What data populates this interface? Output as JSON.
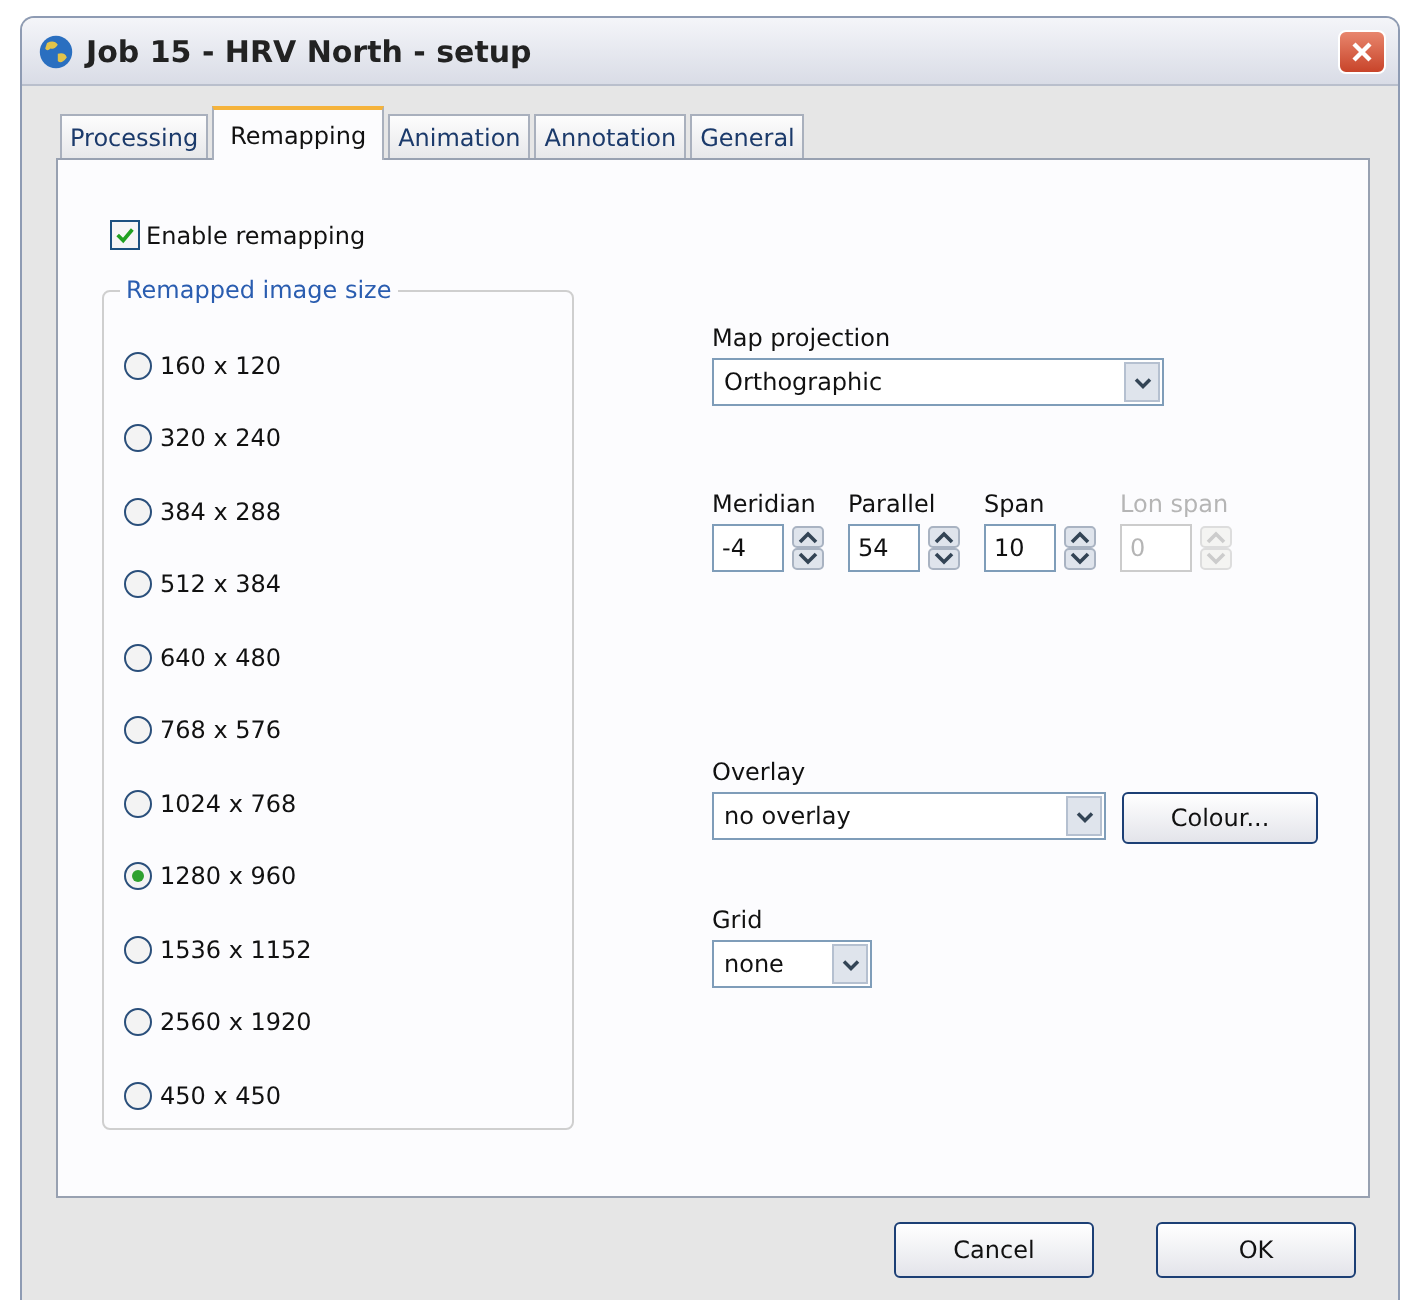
{
  "window": {
    "title": "Job 15 - HRV North - setup"
  },
  "tabs": [
    {
      "label": "Processing",
      "selected": false
    },
    {
      "label": "Remapping",
      "selected": true
    },
    {
      "label": "Animation",
      "selected": false
    },
    {
      "label": "Annotation",
      "selected": false
    },
    {
      "label": "General",
      "selected": false
    }
  ],
  "enable_remapping": {
    "label": "Enable remapping",
    "checked": true
  },
  "image_size": {
    "title": "Remapped image size",
    "options": [
      {
        "label": "160 x 120",
        "selected": false
      },
      {
        "label": "320 x 240",
        "selected": false
      },
      {
        "label": "384 x 288",
        "selected": false
      },
      {
        "label": "512 x 384",
        "selected": false
      },
      {
        "label": "640 x 480",
        "selected": false
      },
      {
        "label": "768 x 576",
        "selected": false
      },
      {
        "label": "1024 x 768",
        "selected": false
      },
      {
        "label": "1280 x 960",
        "selected": true
      },
      {
        "label": "1536 x 1152",
        "selected": false
      },
      {
        "label": "2560 x 1920",
        "selected": false
      },
      {
        "label": "450 x 450",
        "selected": false
      }
    ]
  },
  "map_projection": {
    "label": "Map projection",
    "value": "Orthographic"
  },
  "spinners": [
    {
      "label": "Meridian",
      "value": "-4",
      "disabled": false
    },
    {
      "label": "Parallel",
      "value": "54",
      "disabled": false
    },
    {
      "label": "Span",
      "value": "10",
      "disabled": false
    },
    {
      "label": "Lon span",
      "value": "0",
      "disabled": true
    }
  ],
  "overlay": {
    "label": "Overlay",
    "value": "no overlay",
    "button": "Colour..."
  },
  "grid": {
    "label": "Grid",
    "value": "none"
  },
  "buttons": [
    "Cancel",
    "OK"
  ]
}
